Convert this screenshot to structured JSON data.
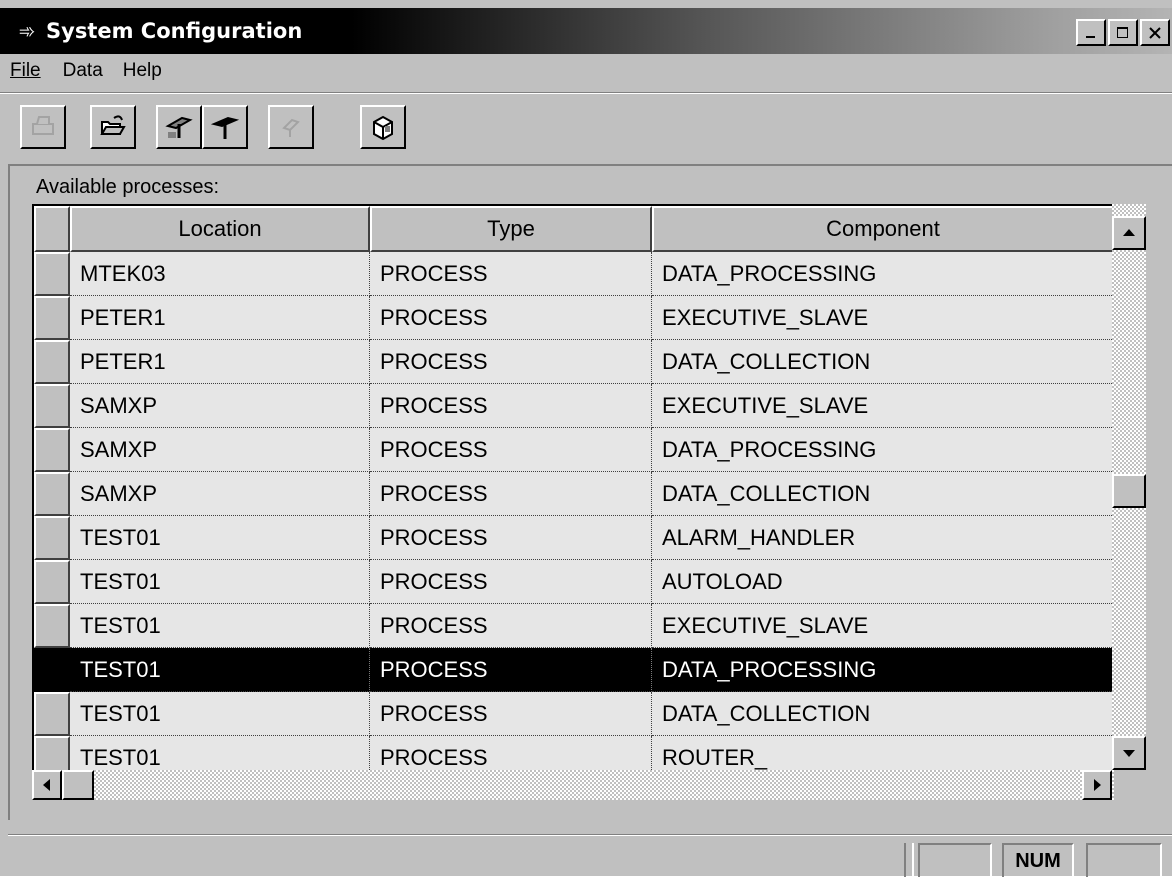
{
  "window": {
    "title": "System Configuration",
    "icon": "arrow-app-icon"
  },
  "menu": {
    "items": [
      {
        "label": "File"
      },
      {
        "label": "Data"
      },
      {
        "label": "Help"
      }
    ]
  },
  "toolbar": {
    "buttons": [
      {
        "icon": "print-icon",
        "enabled": false
      },
      {
        "icon": "open-folder-icon",
        "enabled": true
      },
      {
        "icon": "upload-pin-icon",
        "enabled": true
      },
      {
        "icon": "pin-icon",
        "enabled": true
      },
      {
        "icon": "refresh-pin-icon",
        "enabled": false
      },
      {
        "icon": "config-cube-icon",
        "enabled": true
      }
    ]
  },
  "list": {
    "label": "Available processes:",
    "columns": [
      "Location",
      "Type",
      "Component"
    ],
    "selected_index": 9,
    "rows": [
      [
        "MTEK03",
        "PROCESS",
        "DATA_PROCESSING"
      ],
      [
        "PETER1",
        "PROCESS",
        "EXECUTIVE_SLAVE"
      ],
      [
        "PETER1",
        "PROCESS",
        "DATA_COLLECTION"
      ],
      [
        "SAMXP",
        "PROCESS",
        "EXECUTIVE_SLAVE"
      ],
      [
        "SAMXP",
        "PROCESS",
        "DATA_PROCESSING"
      ],
      [
        "SAMXP",
        "PROCESS",
        "DATA_COLLECTION"
      ],
      [
        "TEST01",
        "PROCESS",
        "ALARM_HANDLER"
      ],
      [
        "TEST01",
        "PROCESS",
        "AUTOLOAD"
      ],
      [
        "TEST01",
        "PROCESS",
        "EXECUTIVE_SLAVE"
      ],
      [
        "TEST01",
        "PROCESS",
        "DATA_PROCESSING"
      ],
      [
        "TEST01",
        "PROCESS",
        "DATA_COLLECTION"
      ],
      [
        "TEST01",
        "PROCESS",
        "ROUTER_"
      ]
    ]
  },
  "statusbar": {
    "num": "NUM"
  }
}
